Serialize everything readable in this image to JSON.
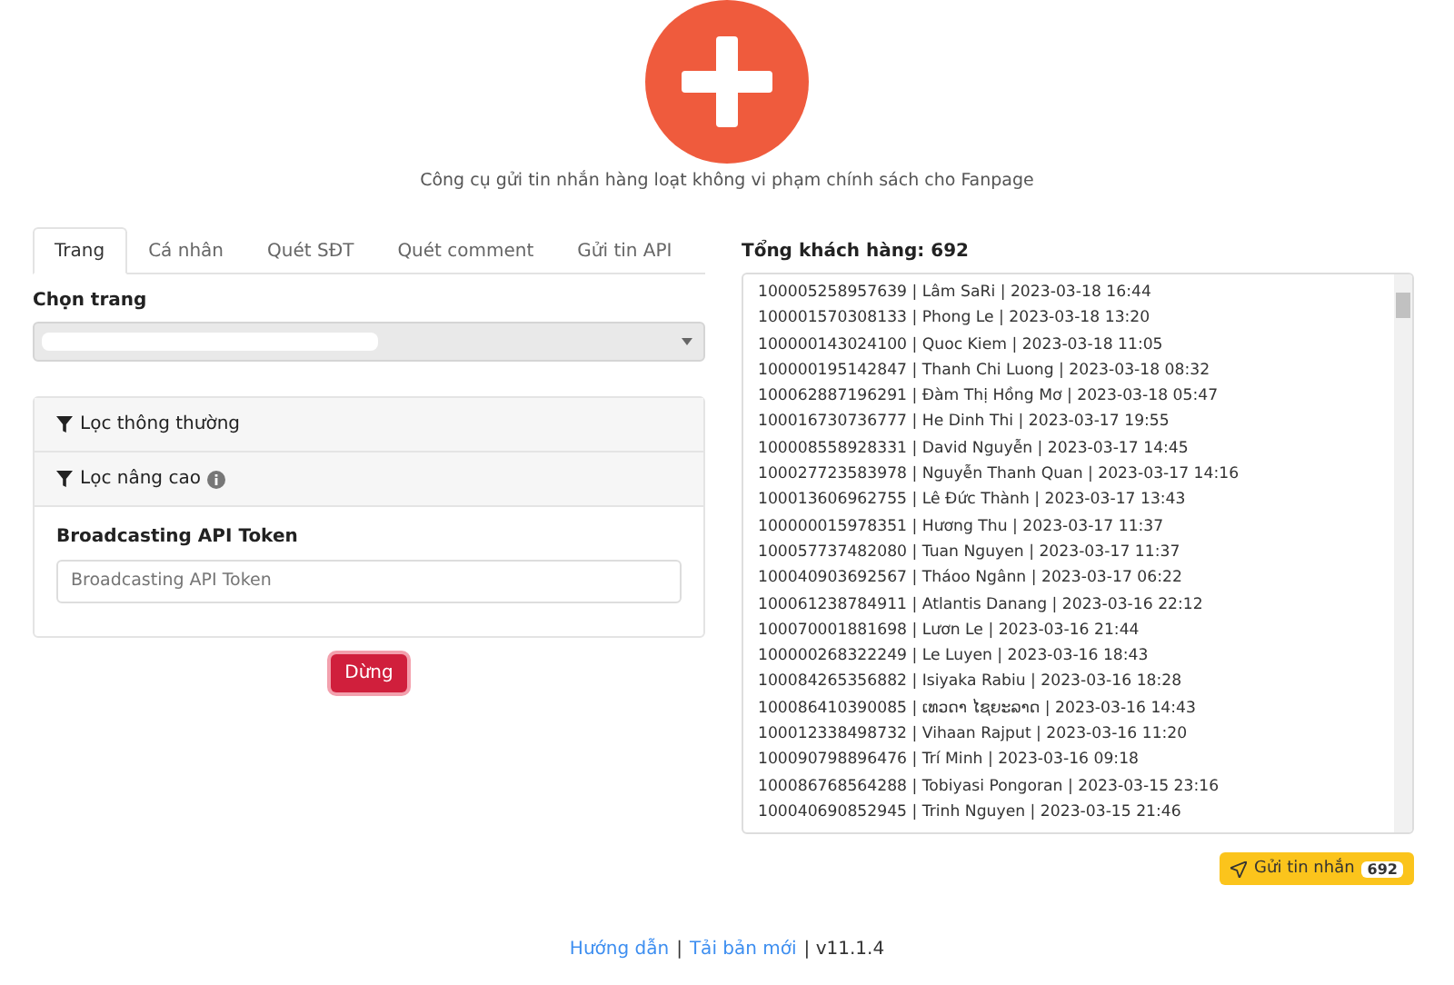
{
  "header": {
    "subtitle": "Công cụ gửi tin nhắn hàng loạt không vi phạm chính sách cho Fanpage"
  },
  "tabs": [
    {
      "label": "Trang",
      "selected": true
    },
    {
      "label": "Cá nhân",
      "selected": false
    },
    {
      "label": "Quét SĐT",
      "selected": false
    },
    {
      "label": "Quét comment",
      "selected": false
    },
    {
      "label": "Gửi tin API",
      "selected": false
    }
  ],
  "page_select": {
    "label": "Chọn trang"
  },
  "filters": [
    {
      "label": "Lọc thông thường",
      "info": false
    },
    {
      "label": "Lọc nâng cao",
      "info": true,
      "token": {
        "label": "Broadcasting API Token",
        "placeholder": "Broadcasting API Token"
      }
    }
  ],
  "stop_button": "Dừng",
  "customers": {
    "title": "Tổng khách hàng: 692",
    "rows": [
      "100005258957639 | Lâm SaRi | 2023-03-18 16:44",
      "100001570308133 | Phong Le | 2023-03-18 13:20",
      "100000143024100 | Quoc Kiem | 2023-03-18 11:05",
      "100000195142847 | Thanh Chi Luong | 2023-03-18 08:32",
      "100062887196291 | Đàm Thị Hồng Mơ | 2023-03-18 05:47",
      "100016730736777 | He Dinh Thi | 2023-03-17 19:55",
      "100008558928331 | David Nguyễn | 2023-03-17 14:45",
      "100027723583978 | Nguyễn Thanh Quan | 2023-03-17 14:16",
      "100013606962755 | Lê Đức Thành | 2023-03-17 13:43",
      "100000015978351 | Hương Thu | 2023-03-17 11:37",
      "100057737482080 | Tuan Nguyen | 2023-03-17 11:37",
      "100040903692567 | Tháoo Ngânn | 2023-03-17 06:22",
      "100061238784911 | Atlantis Danang | 2023-03-16 22:12",
      "100070001881698 | Lươn Le | 2023-03-16 21:44",
      "100000268322249 | Le Luyen | 2023-03-16 18:43",
      "100084265356882 | Isiyaka Rabiu | 2023-03-16 18:28",
      "100086410390085 | ເທວດາ ໄຊຍະລາດ | 2023-03-16 14:43",
      "100012338498732 | Vihaan Rajput | 2023-03-16 11:20",
      "100090798896476 | Trí Minh | 2023-03-16 09:18",
      "100086768564288 | Tobiyasi Pongoran | 2023-03-15 23:16",
      "100040690852945 | Trinh Nguyen | 2023-03-15 21:46"
    ]
  },
  "send_button": {
    "label": "Gửi tin nhắn",
    "count": "692"
  },
  "footer": [
    {
      "kind": "link",
      "text": "Hướng dẫn"
    },
    {
      "kind": "text",
      "text": "|"
    },
    {
      "kind": "link",
      "text": "Tải bản mới"
    },
    {
      "kind": "text",
      "text": "| v11.1.4"
    }
  ]
}
